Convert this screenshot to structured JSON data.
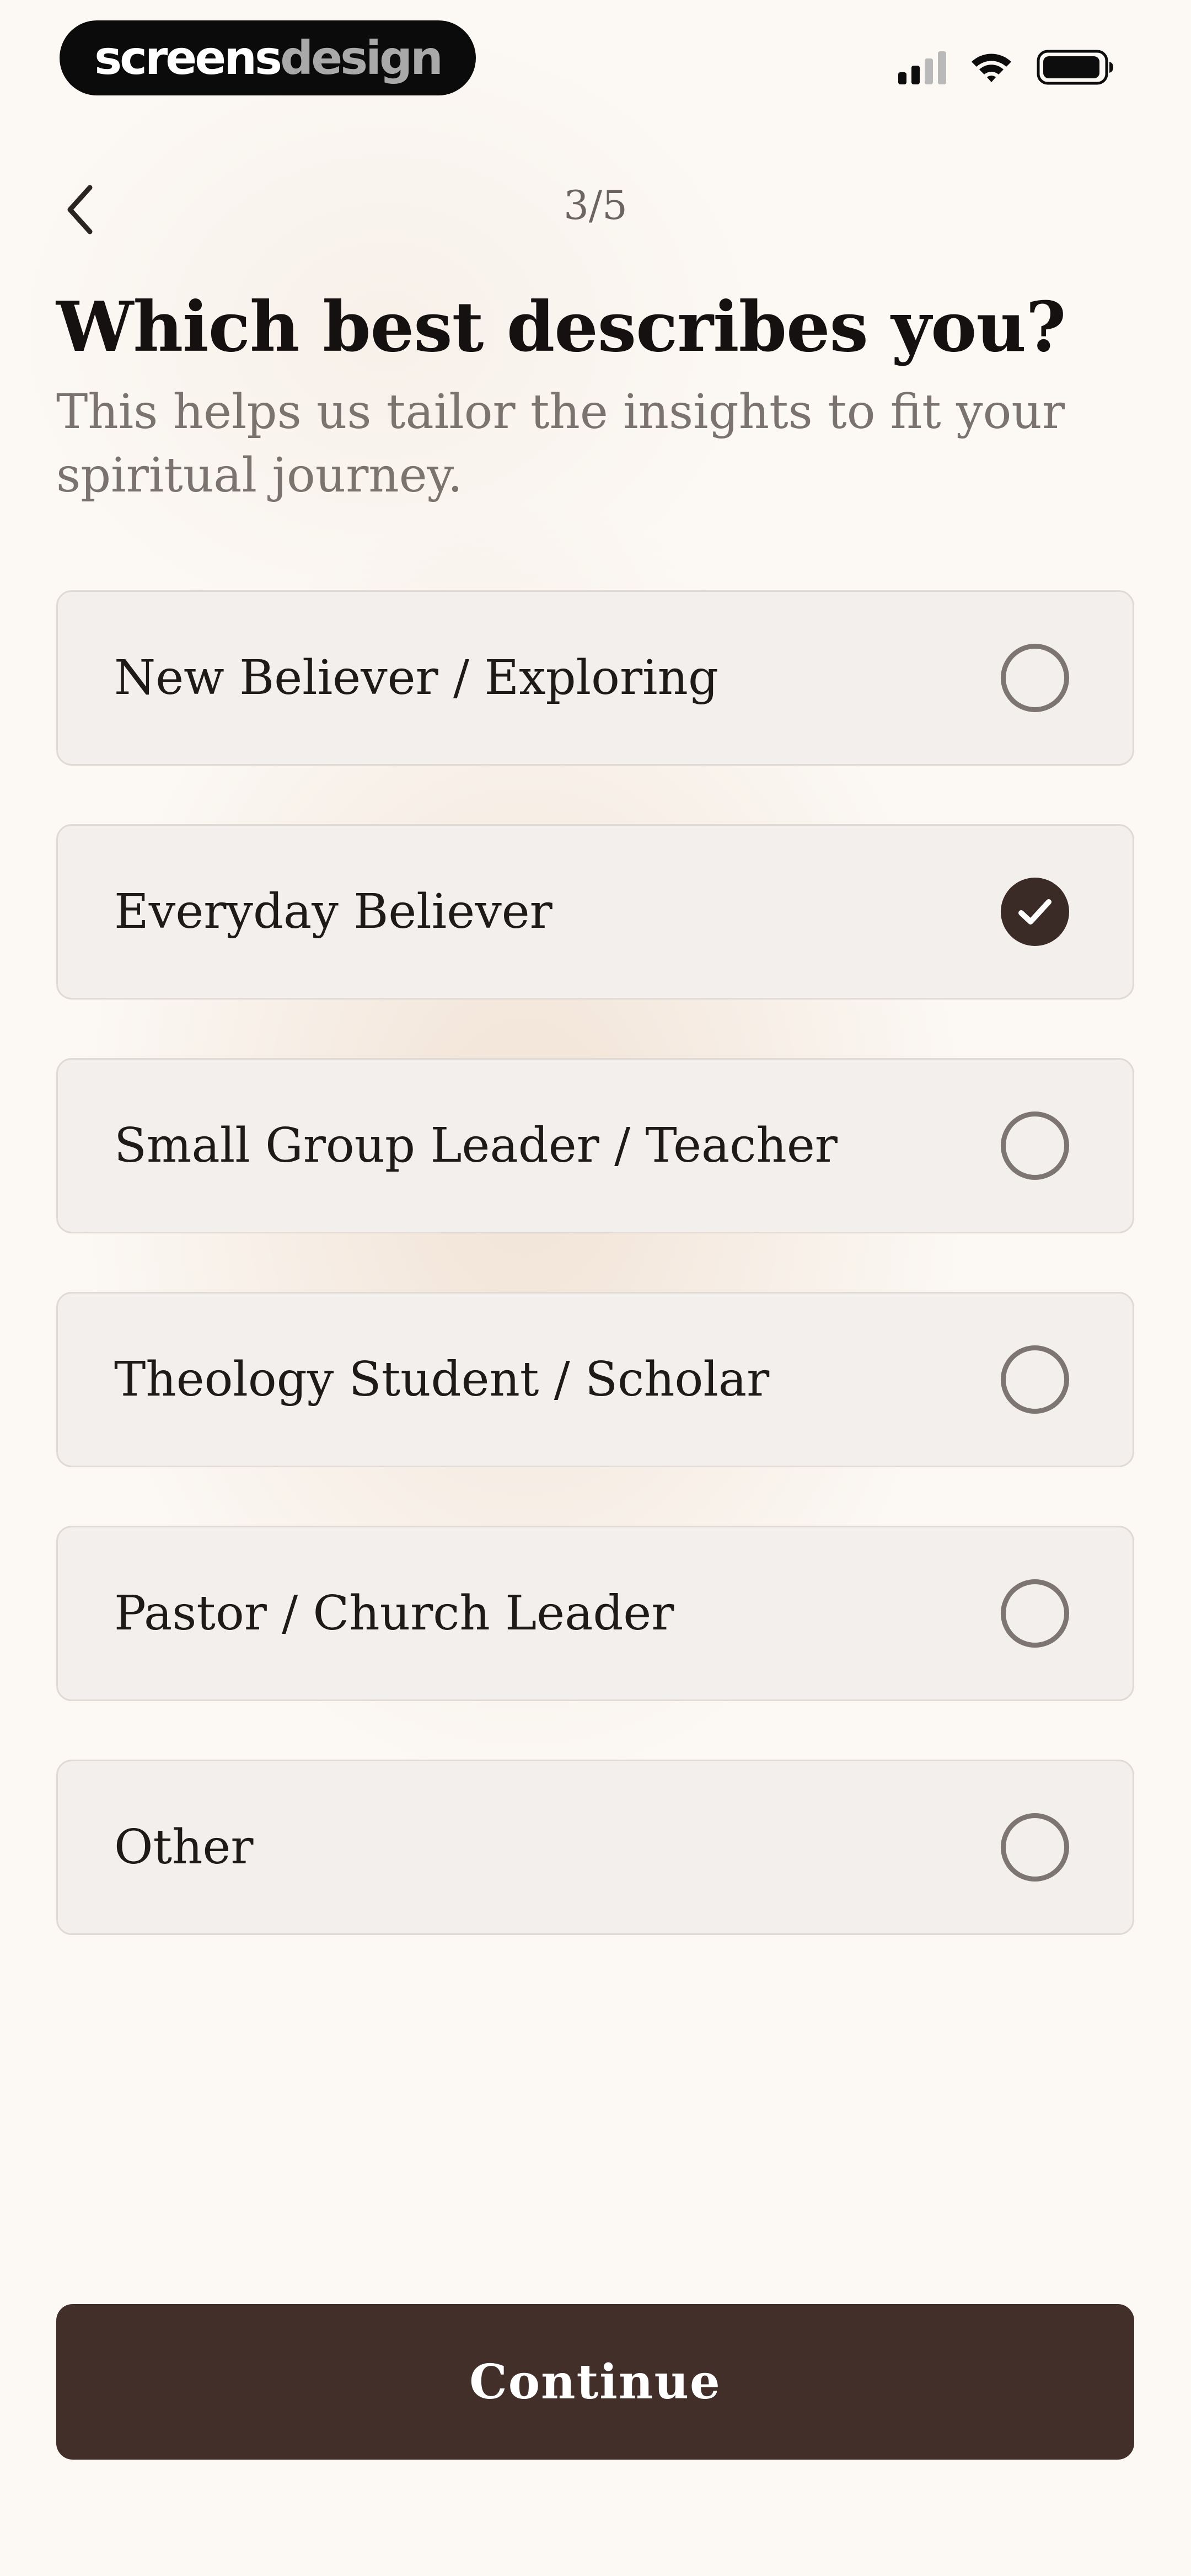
{
  "status_bar": {
    "brand_part1": "screens",
    "brand_part2": "design",
    "icons": [
      "signal-icon",
      "wifi-icon",
      "battery-icon"
    ]
  },
  "header": {
    "back_icon": "chevron-left-icon",
    "step": "3/5"
  },
  "title": "Which best describes you?",
  "subtitle": "This helps us tailor the insights to fit your spiritual journey.",
  "options": [
    {
      "label": "New Believer / Exploring",
      "selected": false
    },
    {
      "label": "Everyday Believer",
      "selected": true
    },
    {
      "label": "Small Group Leader / Teacher",
      "selected": false
    },
    {
      "label": "Theology Student / Scholar",
      "selected": false
    },
    {
      "label": "Pastor / Church Leader",
      "selected": false
    },
    {
      "label": "Other",
      "selected": false
    }
  ],
  "continue_label": "Continue",
  "colors": {
    "accent": "#422f2a",
    "option_bg": "#f2efec",
    "option_border": "#e0d9d4",
    "radio_border": "#7d7571",
    "checked_fill": "#3b2b27",
    "background": "#fcf9f5"
  }
}
